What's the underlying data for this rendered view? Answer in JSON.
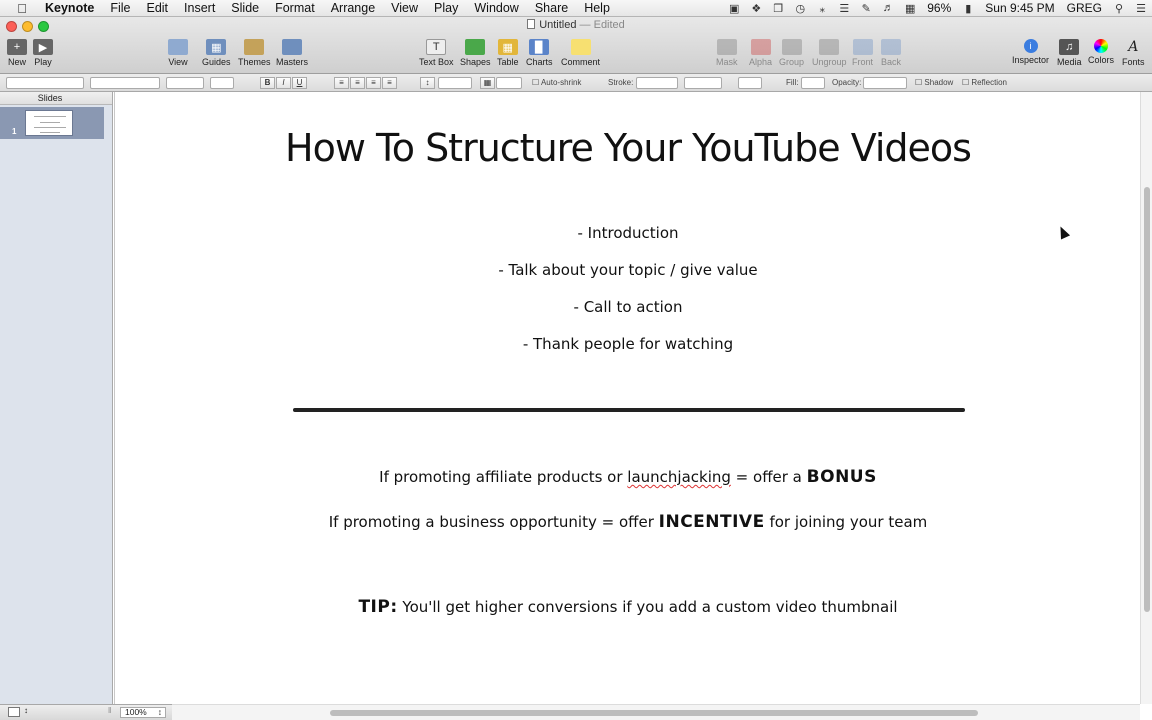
{
  "menubar": {
    "app": "Keynote",
    "items": [
      "File",
      "Edit",
      "Insert",
      "Slide",
      "Format",
      "Arrange",
      "View",
      "Play",
      "Window",
      "Share",
      "Help"
    ],
    "battery": "96%",
    "clock": "Sun 9:45 PM",
    "user": "GREG"
  },
  "window": {
    "title": "Untitled",
    "status": "— Edited"
  },
  "toolbar": {
    "new": "New",
    "play": "Play",
    "view": "View",
    "guides": "Guides",
    "themes": "Themes",
    "masters": "Masters",
    "text_box": "Text Box",
    "shapes": "Shapes",
    "table": "Table",
    "charts": "Charts",
    "comment": "Comment",
    "mask": "Mask",
    "alpha": "Alpha",
    "group": "Group",
    "ungroup": "Ungroup",
    "front": "Front",
    "back": "Back",
    "inspector": "Inspector",
    "media": "Media",
    "colors": "Colors",
    "fonts": "Fonts"
  },
  "formatbar": {
    "auto_shrink": "Auto-shrink",
    "stroke": "Stroke:",
    "fill": "Fill:",
    "opacity": "Opacity:",
    "shadow": "Shadow",
    "reflection": "Reflection"
  },
  "sidebar": {
    "heading": "Slides",
    "slide_number": "1"
  },
  "slide": {
    "title": "How To Structure Your YouTube Videos",
    "bullets": [
      "- Introduction",
      "- Talk about your topic / give value",
      "- Call to action",
      "- Thank people for watching"
    ],
    "promo1_before": "If promoting affiliate products or ",
    "promo1_word": "launchjacking",
    "promo1_mid": " = offer a ",
    "promo1_bold": "BONUS",
    "promo2_before": "If promoting a business opportunity = offer ",
    "promo2_bold": "INCENTIVE",
    "promo2_after": " for joining your team",
    "tip_label": "TIP:",
    "tip_text": "  You'll get higher conversions if you add a custom video thumbnail"
  },
  "statusbar": {
    "zoom": "100%"
  }
}
